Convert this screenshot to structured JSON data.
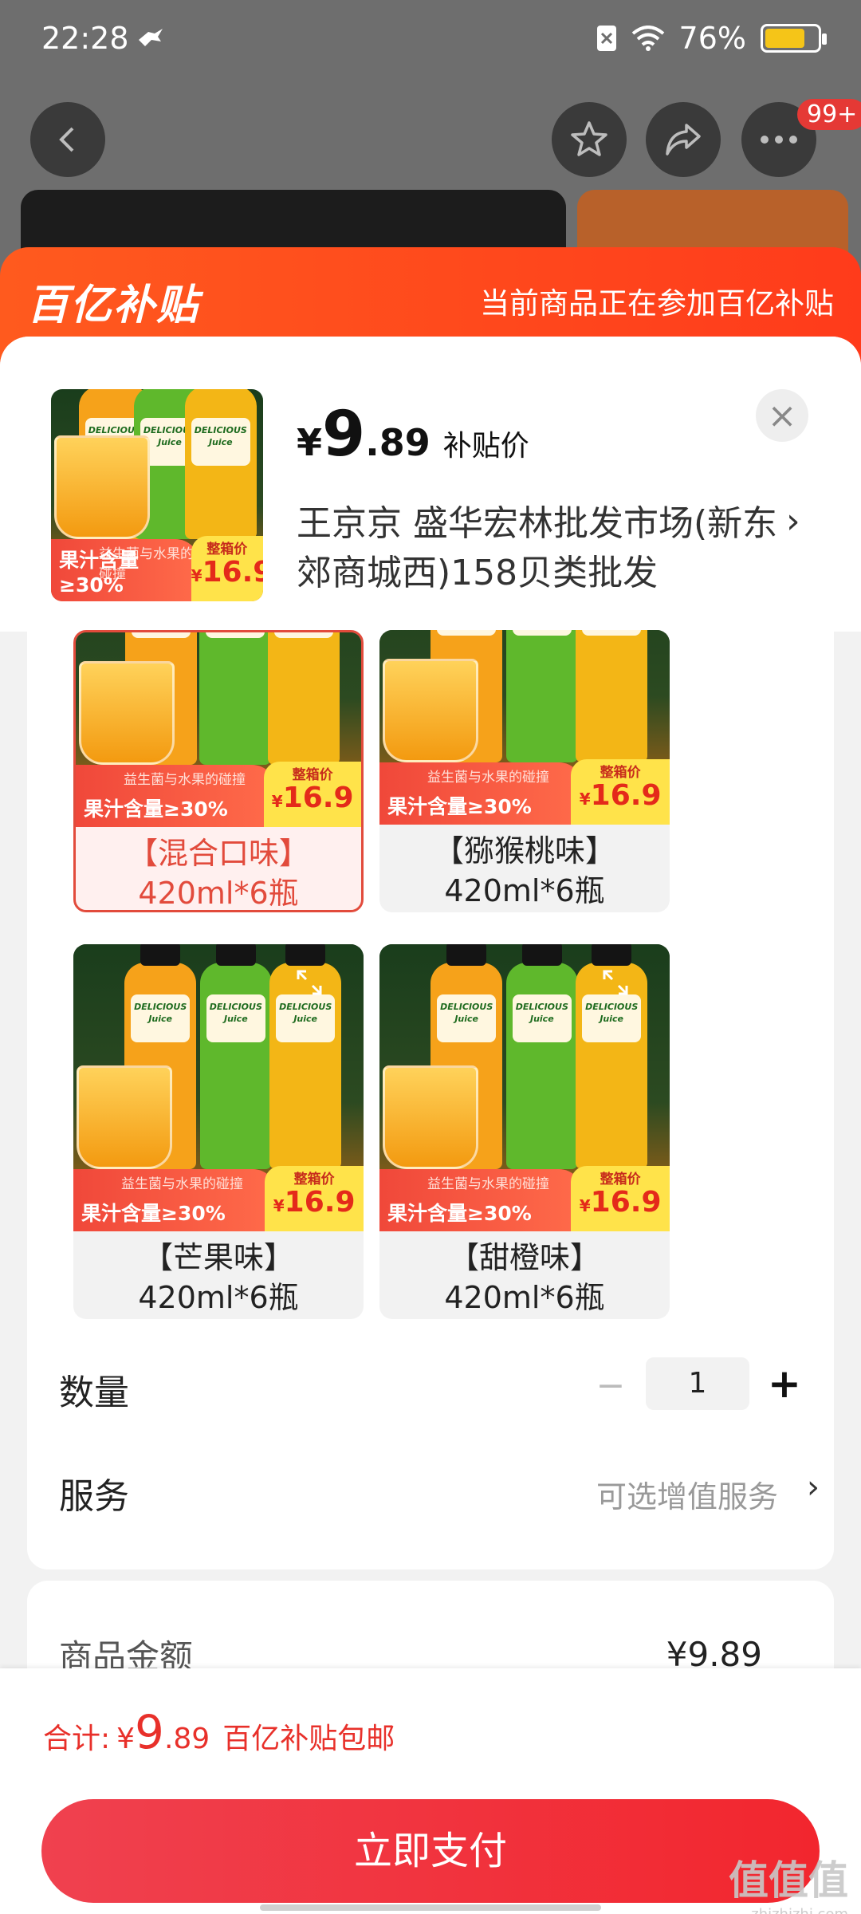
{
  "status_bar": {
    "time": "22:28",
    "battery": "76%"
  },
  "nav": {
    "badge": "99+"
  },
  "banner": {
    "logo": "百亿补贴",
    "message": "当前商品正在参加百亿补贴"
  },
  "product": {
    "currency": "¥",
    "price_int": "9",
    "price_dec": ".89",
    "price_label": "补贴价",
    "seller": "王京京  盛华宏林批发市场(新东郊商城西)158贝类批发"
  },
  "promo": {
    "top": "益生菌与水果的碰撞",
    "main": "果汁含量≥30%",
    "box_label": "整箱价",
    "price_cur": "¥",
    "price": "16.9",
    "bottle_text": "DELICIOUS Juice"
  },
  "variants": [
    {
      "name": "【混合口味】",
      "spec": "420ml*6瓶",
      "selected": true
    },
    {
      "name": "【猕猴桃味】",
      "spec": "420ml*6瓶",
      "selected": false
    },
    {
      "name": "【芒果味】",
      "spec": "420ml*6瓶",
      "selected": false
    },
    {
      "name": "【甜橙味】",
      "spec": "420ml*6瓶",
      "selected": false
    }
  ],
  "quantity": {
    "label": "数量",
    "value": "1",
    "minus": "−",
    "plus": "+"
  },
  "service": {
    "label": "服务",
    "value": "可选增值服务",
    "arrow": "›"
  },
  "amount": {
    "label": "商品金额",
    "value": "¥9.89"
  },
  "total": {
    "label": "合计:",
    "currency": "¥",
    "int": "9",
    "dec": ".89",
    "note": "百亿补贴包邮"
  },
  "pay_button": "立即支付",
  "watermark": {
    "main": "值值值",
    "sub": "zhizhizhi.com"
  },
  "colors": {
    "accent": "#ff4a1c",
    "price_red": "#e8302a",
    "selected_border": "#e24b3c",
    "promo_yellow": "#ffe34a"
  }
}
